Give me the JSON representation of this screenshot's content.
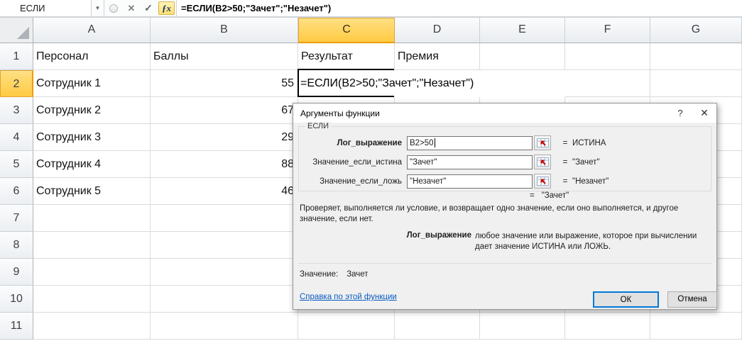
{
  "formula_bar": {
    "name_box": "ЕСЛИ",
    "dropdown_glyph": "▼",
    "cancel_glyph": "✕",
    "enter_glyph": "✓",
    "fx_glyph": "ƒx",
    "formula": "=ЕСЛИ(B2>50;\"Зачет\";\"Незачет\")"
  },
  "columns": [
    "A",
    "B",
    "C",
    "D",
    "E",
    "F",
    "G"
  ],
  "selected_column": "C",
  "selected_row": "2",
  "row_numbers": [
    "1",
    "2",
    "3",
    "4",
    "5",
    "6",
    "7",
    "8",
    "9",
    "10",
    "11"
  ],
  "cells": {
    "a1": "Персонал",
    "b1": "Баллы",
    "c1": "Результат",
    "d1": "Премия",
    "a2": "Сотрудник 1",
    "b2": "55",
    "c2_formula": "=ЕСЛИ(B2>50;\"Зачет\";\"Незачет\")",
    "a3": "Сотрудник 2",
    "b3": "67",
    "a4": "Сотрудник 3",
    "b4": "29",
    "a5": "Сотрудник 4",
    "b5": "88",
    "a6": "Сотрудник 5",
    "b6": "46"
  },
  "dialog": {
    "title": "Аргументы функции",
    "help_glyph": "?",
    "close_glyph": "✕",
    "group_label": "ЕСЛИ",
    "fields": [
      {
        "label": "Лог_выражение",
        "value": "B2>50",
        "equals": "=",
        "result": "ИСТИНА"
      },
      {
        "label": "Значение_если_истина",
        "value": "\"Зачет\"",
        "equals": "=",
        "result": "\"Зачет\""
      },
      {
        "label": "Значение_если_ложь",
        "value": "\"Незачет\"",
        "equals": "=",
        "result": "\"Незачет\""
      }
    ],
    "overall_equals": "=",
    "overall_result": "\"Зачет\"",
    "description": "Проверяет, выполняется ли условие, и возвращает одно значение, если оно выполняется, и другое значение, если нет.",
    "arg_name": "Лог_выражение",
    "arg_description": "любое значение или выражение, которое при вычислении дает значение ИСТИНА или ЛОЖЬ.",
    "value_label": "Значение:",
    "value_result": "Зачет",
    "help_link": "Справка по этой функции",
    "ok_label": "ОК",
    "cancel_label": "Отмена"
  },
  "colors": {
    "selected_header": "#FFCA43",
    "selected_header_border": "#EE9D00",
    "ok_focus_border": "#0078D7",
    "link": "#0A5BC4",
    "fx_highlight": "#FFDF71"
  }
}
